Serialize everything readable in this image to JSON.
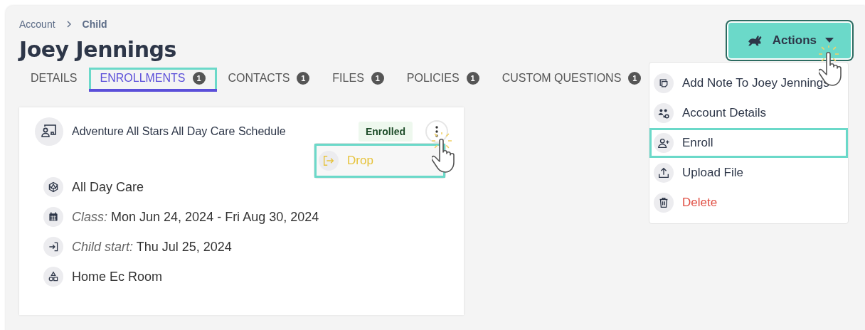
{
  "breadcrumb": [
    {
      "label": "Account",
      "current": false
    },
    {
      "label": "Child",
      "current": true
    }
  ],
  "title": "Joey Jennings",
  "tabs": [
    {
      "label": "DETAILS",
      "selected": false,
      "highlighted": false
    },
    {
      "label": "ENROLLMENTS",
      "count": "1",
      "selected": true,
      "highlighted": true
    },
    {
      "label": "CONTACTS",
      "count": "1",
      "selected": false,
      "highlighted": false
    },
    {
      "label": "FILES",
      "count": "1",
      "selected": false,
      "highlighted": false
    },
    {
      "label": "POLICIES",
      "count": "1",
      "selected": false,
      "highlighted": false
    },
    {
      "label": "CUSTOM QUESTIONS",
      "count": "1",
      "selected": false,
      "highlighted": false
    }
  ],
  "actions_button": {
    "label": "Actions",
    "highlighted": true
  },
  "actions_menu": [
    {
      "kind": "note",
      "label": "Add Note To Joey Jennings",
      "highlighted": false
    },
    {
      "kind": "account",
      "label": "Account Details",
      "highlighted": false
    },
    {
      "kind": "enroll",
      "label": "Enroll",
      "highlighted": true
    },
    {
      "kind": "upload",
      "label": "Upload File",
      "highlighted": false
    },
    {
      "kind": "delete",
      "label": "Delete",
      "highlighted": false
    }
  ],
  "enrollment": {
    "title": "Adventure All Stars All Day Care Schedule",
    "status": "Enrolled",
    "menu": [
      {
        "label": "Drop",
        "highlighted": true
      }
    ],
    "details": [
      {
        "kind": "program",
        "value": "All Day Care"
      },
      {
        "kind": "class",
        "label": "Class:",
        "value": "Mon Jun 24, 2024 - Fri Aug 30, 2024"
      },
      {
        "kind": "start",
        "label": "Child start:",
        "value": "Thu Jul 25, 2024"
      },
      {
        "kind": "room",
        "value": "Home Ec Room"
      }
    ]
  }
}
